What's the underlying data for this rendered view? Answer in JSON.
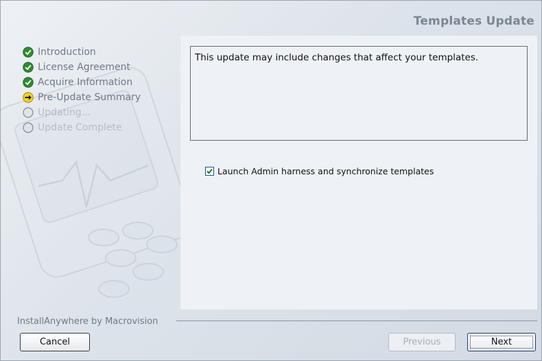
{
  "window": {
    "title": "Templates Update"
  },
  "steps": [
    {
      "label": "Introduction",
      "state": "done",
      "icon": "checkmark-icon"
    },
    {
      "label": "License Agreement",
      "state": "done",
      "icon": "checkmark-icon"
    },
    {
      "label": "Acquire Information",
      "state": "done",
      "icon": "checkmark-icon"
    },
    {
      "label": "Pre-Update Summary",
      "state": "current",
      "icon": "arrow-right-icon"
    },
    {
      "label": "Updating...",
      "state": "pending",
      "icon": "empty-circle-icon"
    },
    {
      "label": "Update Complete",
      "state": "pending",
      "icon": "empty-circle-icon"
    }
  ],
  "content": {
    "description": "This update may include changes that affect your templates.",
    "checkbox": {
      "label": "Launch Admin harness and synchronize templates",
      "checked": true
    }
  },
  "footer": {
    "brand": "InstallAnywhere by Macrovision",
    "cancel_label": "Cancel",
    "previous_label": "Previous",
    "next_label": "Next",
    "previous_enabled": false
  },
  "colors": {
    "done": "#2e8b2e",
    "current": "#f2d21a",
    "pending": "#c3c9d0",
    "accent": "#1c5180"
  }
}
